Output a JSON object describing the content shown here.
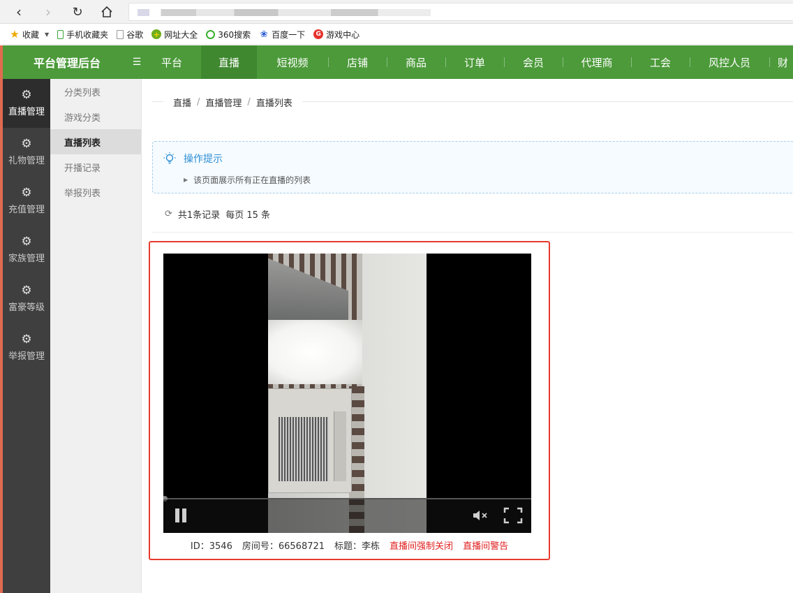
{
  "bookmarks": [
    {
      "label": "收藏",
      "icon": "star-icon"
    },
    {
      "label": "手机收藏夹",
      "icon": "phone-icon"
    },
    {
      "label": "谷歌",
      "icon": "page-icon"
    },
    {
      "label": "网址大全",
      "icon": "plus-circle-icon"
    },
    {
      "label": "360搜索",
      "icon": "search-ring-icon"
    },
    {
      "label": "百度一下",
      "icon": "paw-icon"
    },
    {
      "label": "游戏中心",
      "icon": "game-icon"
    }
  ],
  "header": {
    "brand": "平台管理后台",
    "nav": [
      "平台",
      "直播",
      "短视频",
      "店铺",
      "商品",
      "订单",
      "会员",
      "代理商",
      "工会",
      "风控人员",
      "财"
    ],
    "active_nav": "直播"
  },
  "side1": {
    "items": [
      "直播管理",
      "礼物管理",
      "充值管理",
      "家族管理",
      "富豪等级",
      "举报管理"
    ],
    "active": "直播管理"
  },
  "side2": {
    "items": [
      "分类列表",
      "游戏分类",
      "直播列表",
      "开播记录",
      "举报列表"
    ],
    "active": "直播列表"
  },
  "breadcrumb": [
    "直播",
    "直播管理",
    "直播列表"
  ],
  "tip": {
    "title": "操作提示",
    "text": "该页面展示所有正在直播的列表"
  },
  "records": {
    "total": "共1条记录",
    "per_page": "每页 15 条"
  },
  "stream": {
    "id": "ID：3546",
    "room": "房间号：66568721",
    "title": "标题：李栋",
    "close_action": "直播间强制关闭",
    "warn_action": "直播间警告",
    "progress": 0
  },
  "colors": {
    "header_green": "#4c9a3a",
    "active_green": "#3f8830",
    "sidebar_dark": "#3f3f3f",
    "danger_red": "#e02020",
    "tip_blue": "#2f8fd6"
  }
}
